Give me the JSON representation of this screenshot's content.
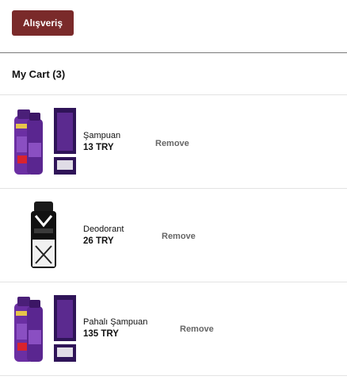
{
  "header": {
    "shop_button": "Alışveriş"
  },
  "cart": {
    "title": "My Cart (3)",
    "items": [
      {
        "name": "Şampuan",
        "price": "13 TRY",
        "remove": "Remove",
        "image": "purple-shampoo-product-image"
      },
      {
        "name": "Deodorant",
        "price": "26 TRY",
        "remove": "Remove",
        "image": "deodorant-spray-product-image"
      },
      {
        "name": "Pahalı Şampuan",
        "price": "135 TRY",
        "remove": "Remove",
        "image": "purple-shampoo-product-image"
      }
    ]
  },
  "colors": {
    "button_bg": "#7a2a2a",
    "remove_text": "#666666",
    "divider": "#e3e3e3"
  }
}
